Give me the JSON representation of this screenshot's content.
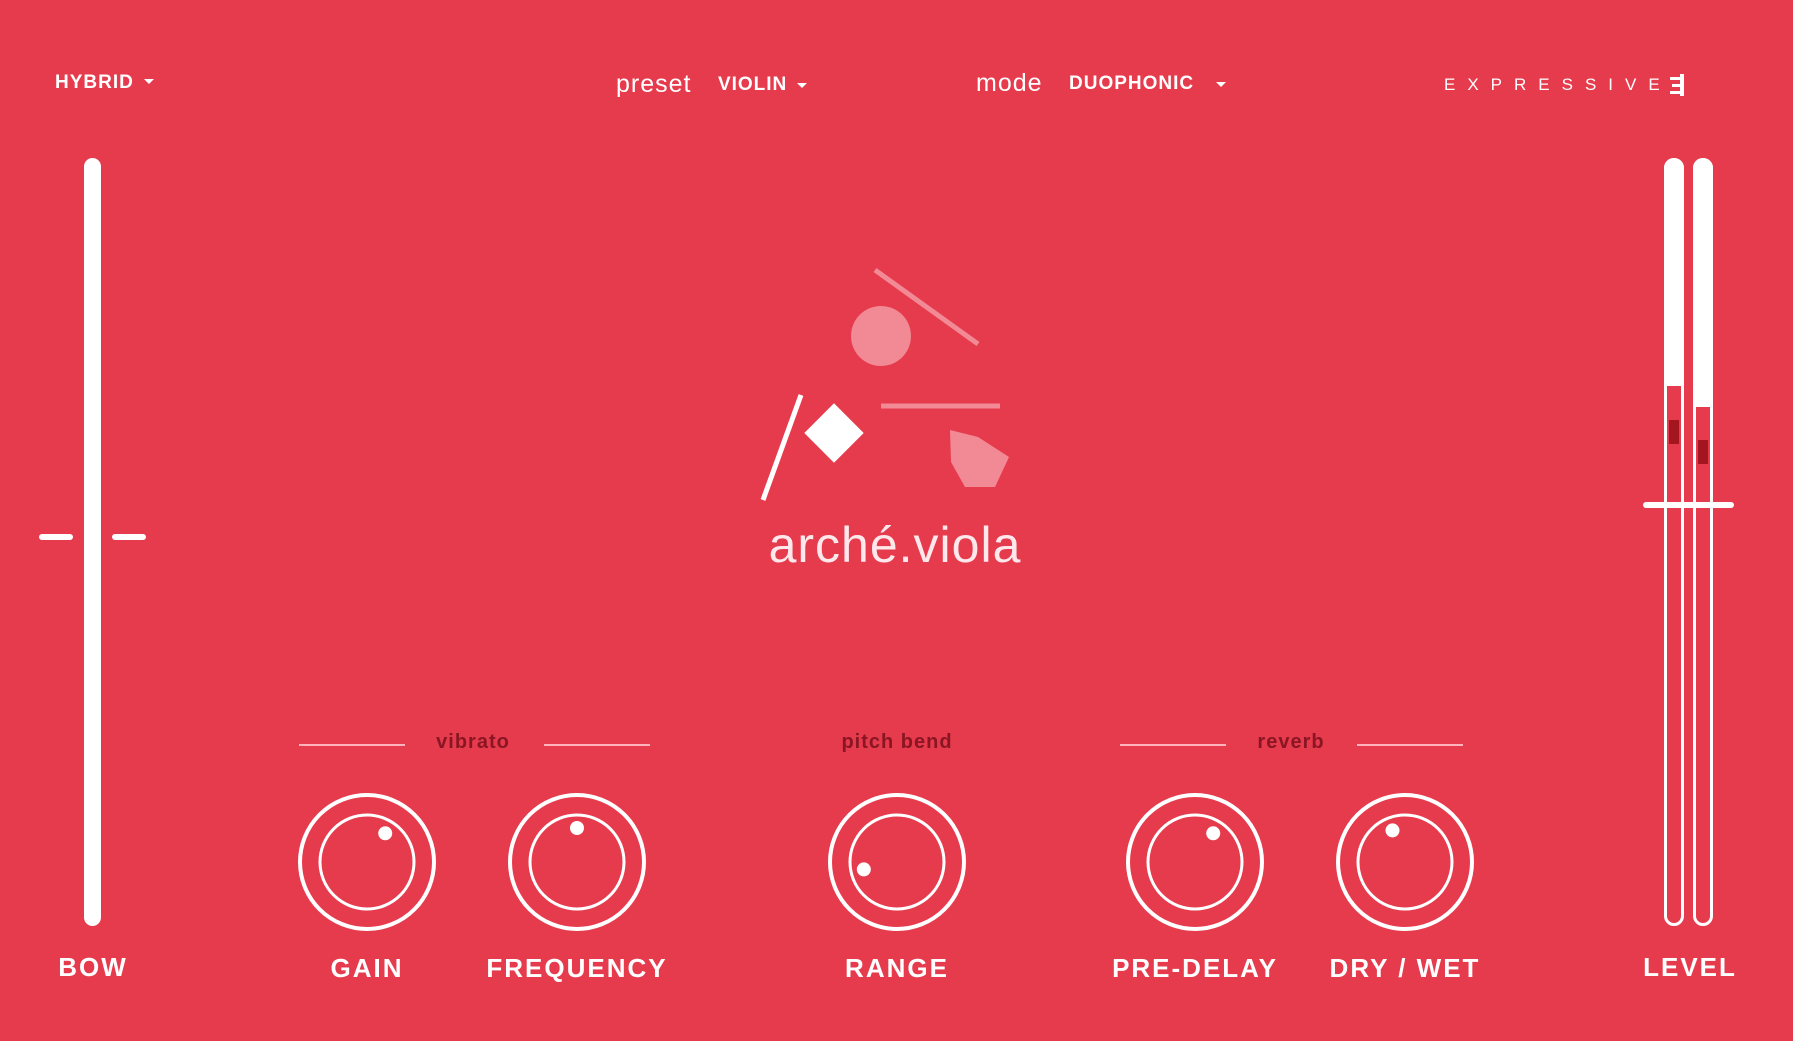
{
  "header": {
    "mode_selector": {
      "value": "HYBRID"
    },
    "preset": {
      "label": "preset",
      "value": "VIOLIN"
    },
    "mode": {
      "label": "mode",
      "value": "DUOPHONIC"
    },
    "brand": {
      "text": "EXPRESSIVE"
    }
  },
  "center": {
    "instrument_name": "arché.viola",
    "logo_icon": "abstract-shapes-logo"
  },
  "groups": {
    "vibrato": "vibrato",
    "pitch_bend": "pitch bend",
    "reverb": "reverb"
  },
  "knobs": [
    {
      "label": "GAIN",
      "value": 0.62
    },
    {
      "label": "FREQUENCY",
      "value": 0.5
    },
    {
      "label": "RANGE",
      "value": 0.12
    },
    {
      "label": "PRE-DELAY",
      "value": 0.62
    },
    {
      "label": "DRY / WET",
      "value": 0.42
    }
  ],
  "bow": {
    "label": "BOW",
    "value": 0.5
  },
  "level": {
    "label": "LEVEL",
    "meters": [
      0.63,
      0.6
    ]
  },
  "colors": {
    "background": "#e63b4d",
    "accent": "#ffffff",
    "group_label": "#8a1624"
  }
}
